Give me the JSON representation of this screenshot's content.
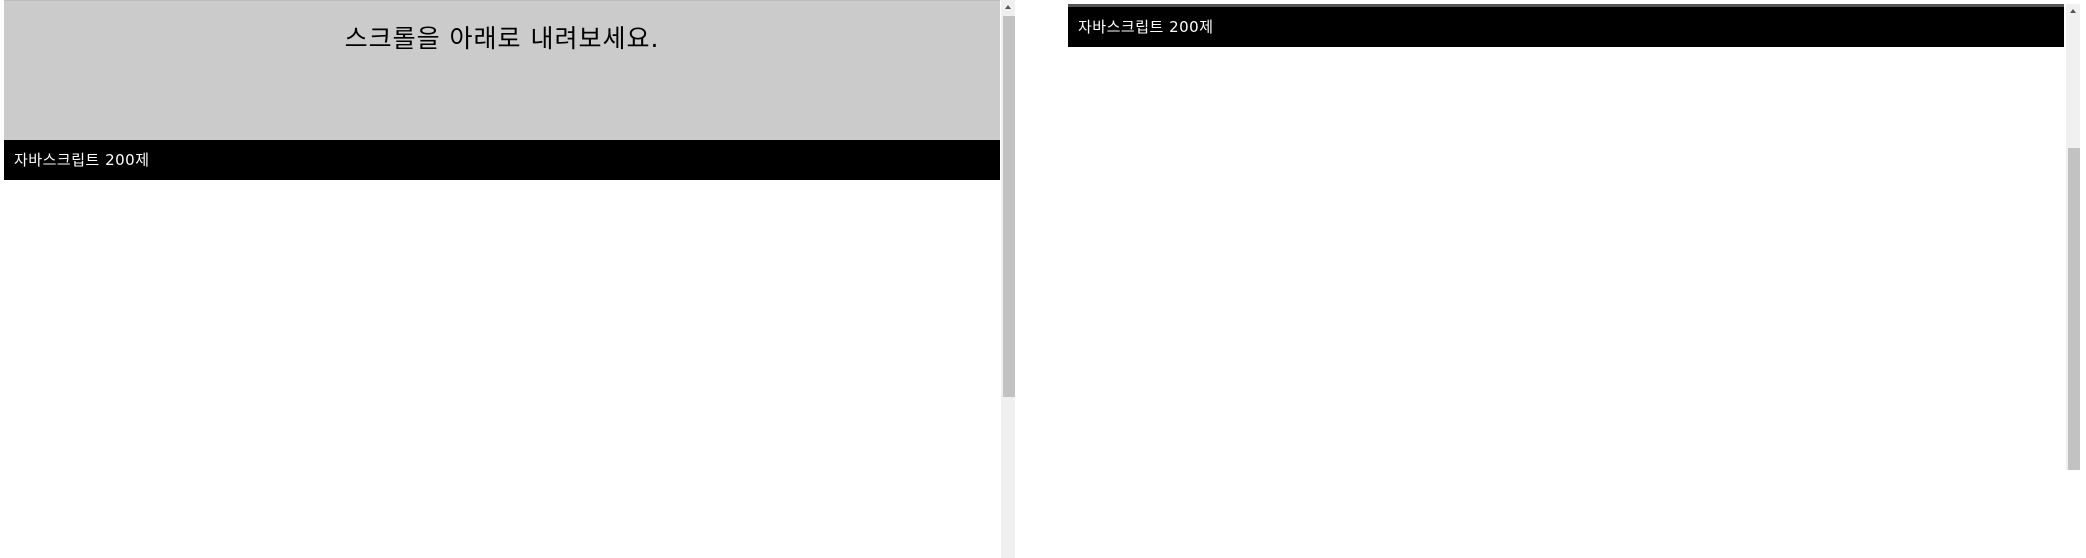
{
  "left_panel": {
    "header_title": "스크롤을 아래로 내려보세요.",
    "nav_title": "자바스크립트 200제"
  },
  "right_panel": {
    "nav_title": "자바스크립트 200제"
  },
  "colors": {
    "header_background": "#cbcbcb",
    "nav_background": "#000000",
    "nav_text": "#ffffff",
    "page_background": "#ffffff",
    "scroll_thumb": "#c2c2c2",
    "scroll_track": "#f0f0f0"
  },
  "icons": {
    "scroll_up": "triangle-up-icon"
  }
}
